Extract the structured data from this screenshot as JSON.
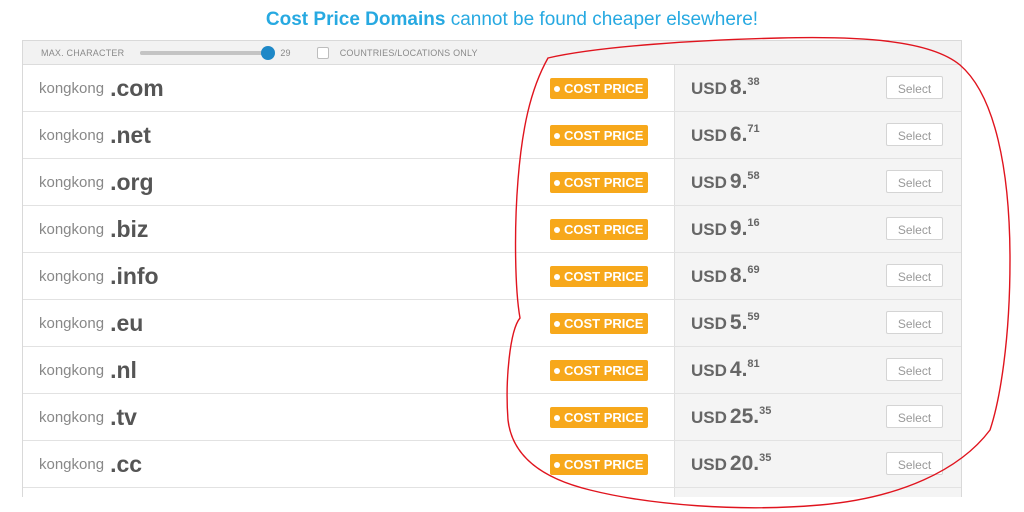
{
  "headline": {
    "bold": "Cost Price Domains",
    "rest": "cannot be found cheaper elsewhere!"
  },
  "filters": {
    "max_character_label": "MAX. CHARACTER",
    "max_character_value": "29",
    "slider_fraction": 1.0,
    "countries_label": "COUNTRIES/LOCATIONS ONLY",
    "countries_checked": false
  },
  "colors": {
    "accent_blue": "#27a9e1",
    "badge_orange": "#f7a81b",
    "slider_knob": "#1e88c7",
    "annotation_red": "#e0141e"
  },
  "rows": [
    {
      "name": "kongkong",
      "tld": ".com",
      "badge": "COST PRICE",
      "currency": "USD",
      "price_int": "8.",
      "price_dec": "38",
      "button": "Select"
    },
    {
      "name": "kongkong",
      "tld": ".net",
      "badge": "COST PRICE",
      "currency": "USD",
      "price_int": "6.",
      "price_dec": "71",
      "button": "Select"
    },
    {
      "name": "kongkong",
      "tld": ".org",
      "badge": "COST PRICE",
      "currency": "USD",
      "price_int": "9.",
      "price_dec": "58",
      "button": "Select"
    },
    {
      "name": "kongkong",
      "tld": ".biz",
      "badge": "COST PRICE",
      "currency": "USD",
      "price_int": "9.",
      "price_dec": "16",
      "button": "Select"
    },
    {
      "name": "kongkong",
      "tld": ".info",
      "badge": "COST PRICE",
      "currency": "USD",
      "price_int": "8.",
      "price_dec": "69",
      "button": "Select"
    },
    {
      "name": "kongkong",
      "tld": ".eu",
      "badge": "COST PRICE",
      "currency": "USD",
      "price_int": "5.",
      "price_dec": "59",
      "button": "Select"
    },
    {
      "name": "kongkong",
      "tld": ".nl",
      "badge": "COST PRICE",
      "currency": "USD",
      "price_int": "4.",
      "price_dec": "81",
      "button": "Select"
    },
    {
      "name": "kongkong",
      "tld": ".tv",
      "badge": "COST PRICE",
      "currency": "USD",
      "price_int": "25.",
      "price_dec": "35",
      "button": "Select"
    },
    {
      "name": "kongkong",
      "tld": ".cc",
      "badge": "COST PRICE",
      "currency": "USD",
      "price_int": "20.",
      "price_dec": "35",
      "button": "Select"
    }
  ]
}
